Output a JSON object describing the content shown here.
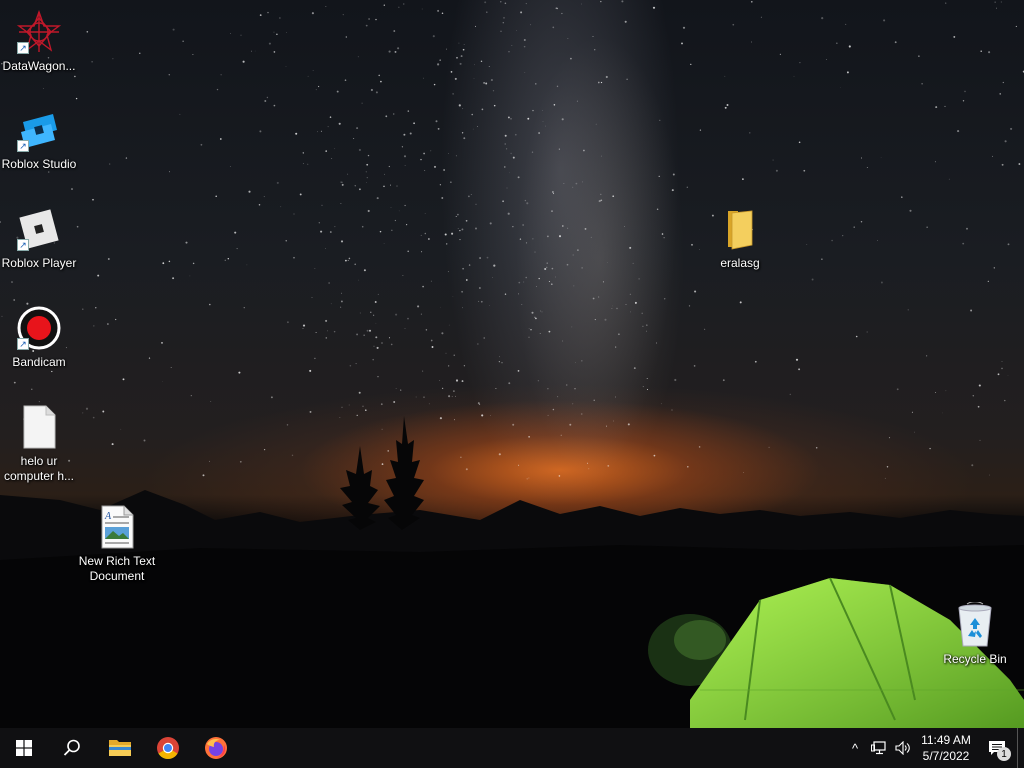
{
  "desktop": {
    "icons": [
      {
        "label": "DataWagon...",
        "icon": "datawagon-star-icon",
        "shortcut": true
      },
      {
        "label": "Roblox Studio",
        "icon": "roblox-studio-icon",
        "shortcut": true
      },
      {
        "label": "Roblox Player",
        "icon": "roblox-player-icon",
        "shortcut": true
      },
      {
        "label": "Bandicam",
        "icon": "bandicam-record-icon",
        "shortcut": true
      },
      {
        "label": "helo ur computer h...",
        "icon": "blank-file-icon",
        "shortcut": false
      },
      {
        "label": "New Rich Text Document",
        "icon": "rich-text-document-icon",
        "shortcut": false
      },
      {
        "label": "eralasg",
        "icon": "folder-icon",
        "shortcut": false
      },
      {
        "label": "Recycle Bin",
        "icon": "recycle-bin-icon",
        "shortcut": false
      }
    ]
  },
  "taskbar": {
    "start": "windows-start-icon",
    "search": "search-icon",
    "pinned": [
      "file-explorer-icon",
      "chrome-icon",
      "firefox-icon"
    ],
    "tray": {
      "chevron": "^",
      "time": "11:49 AM",
      "date": "5/7/2022",
      "notification_count": "1"
    }
  },
  "colors": {
    "taskbar_bg": "#101012",
    "tent_green": "#8fe23a",
    "horizon_orange": "#e86a1e",
    "bandicam_red": "#e8141b",
    "roblox_studio_blue": "#1a9be8"
  }
}
